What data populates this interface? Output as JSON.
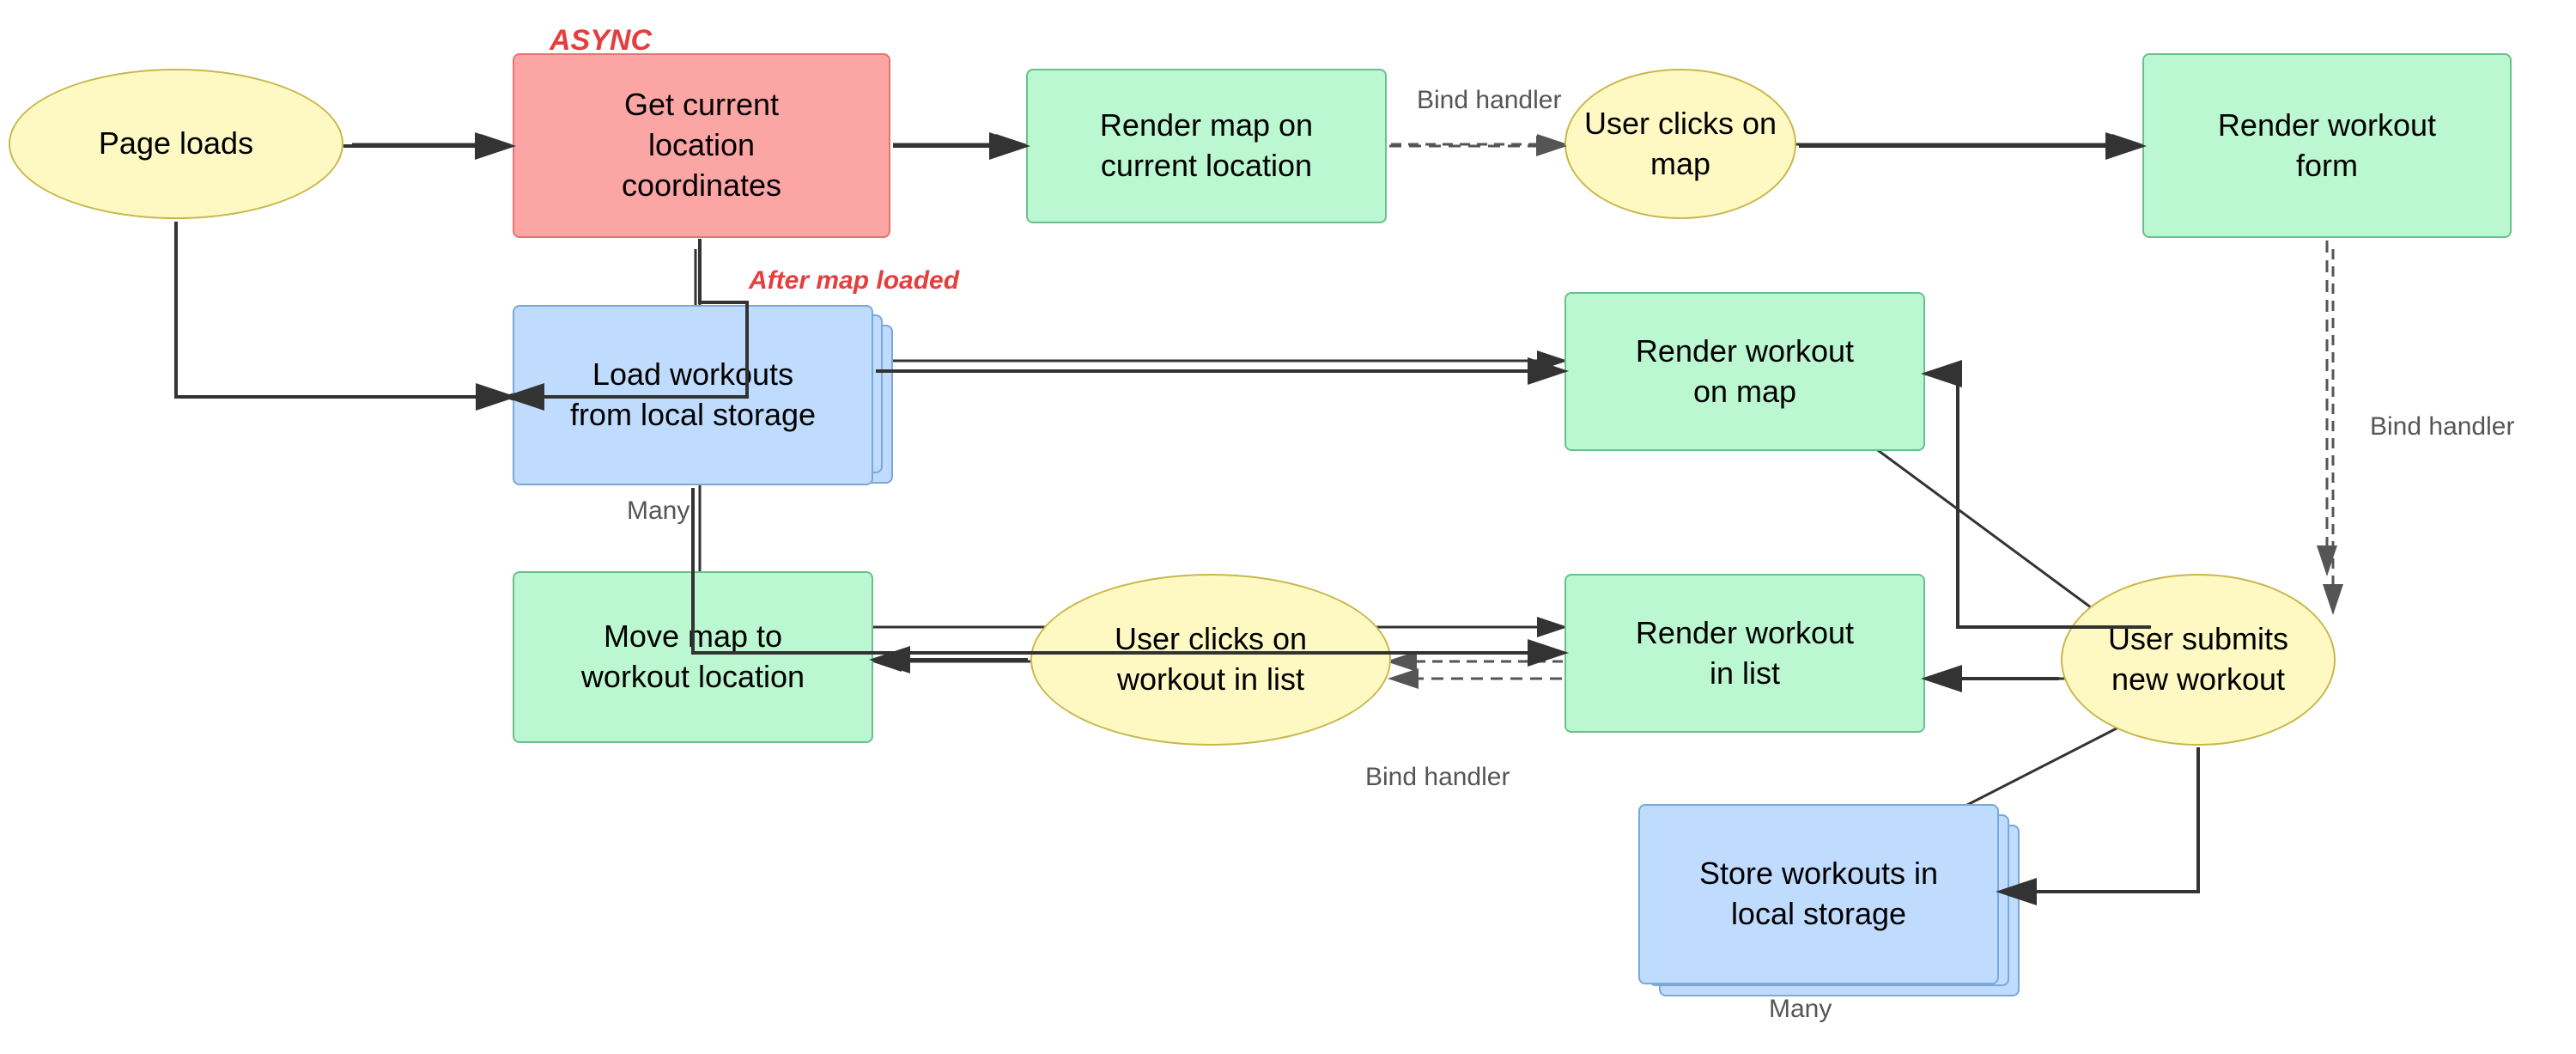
{
  "nodes": {
    "page_loads": {
      "label": "Page loads"
    },
    "get_location": {
      "label": "Get current\nlocation\ncoordinates"
    },
    "async_label": {
      "label": "ASYNC"
    },
    "render_map": {
      "label": "Render map on\ncurrent location"
    },
    "bind_handler_1": {
      "label": "Bind handler"
    },
    "user_clicks_map": {
      "label": "User clicks on\nmap"
    },
    "render_workout_form": {
      "label": "Render workout\nform"
    },
    "bind_handler_2": {
      "label": "Bind handler"
    },
    "load_workouts": {
      "label": "Load workouts\nfrom local storage"
    },
    "many_load": {
      "label": "Many"
    },
    "after_map_loaded": {
      "label": "After map loaded"
    },
    "render_workout_map": {
      "label": "Render workout\non map"
    },
    "render_workout_list": {
      "label": "Render workout\nin list"
    },
    "user_submits": {
      "label": "User submits\nnew workout"
    },
    "user_clicks_workout": {
      "label": "User clicks on\nworkout in list"
    },
    "bind_handler_3": {
      "label": "Bind handler"
    },
    "move_map": {
      "label": "Move map to\nworkout location"
    },
    "store_workouts": {
      "label": "Store workouts in\nlocal storage"
    },
    "many_store": {
      "label": "Many"
    }
  }
}
